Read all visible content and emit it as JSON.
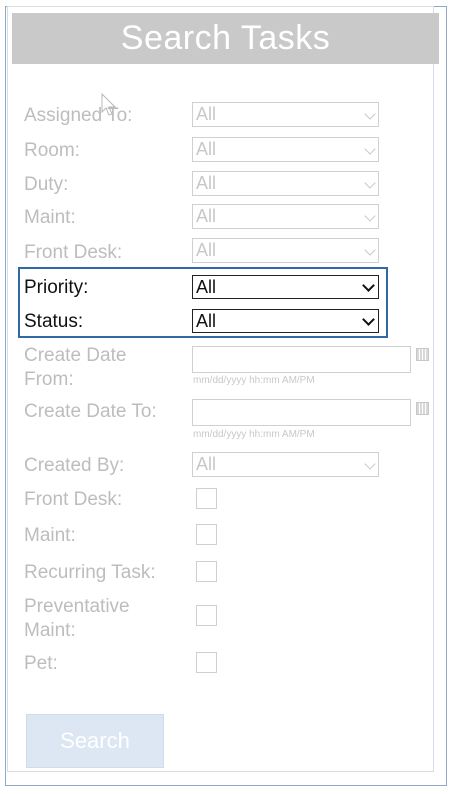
{
  "header": {
    "title": "Search Tasks"
  },
  "filters": {
    "assigned_to": {
      "label": "Assigned To:",
      "value": "All"
    },
    "room": {
      "label": "Room:",
      "value": "All"
    },
    "duty": {
      "label": "Duty:",
      "value": "All"
    },
    "maint": {
      "label": "Maint:",
      "value": "All"
    },
    "front_desk": {
      "label": "Front Desk:",
      "value": "All"
    },
    "priority": {
      "label": "Priority:",
      "value": "All"
    },
    "status": {
      "label": "Status:",
      "value": "All"
    },
    "create_date_from": {
      "label_line1": "Create Date",
      "label_line2": "From:",
      "value": "",
      "hint": "mm/dd/yyyy hh:mm AM/PM"
    },
    "create_date_to": {
      "label": "Create Date To:",
      "value": "",
      "hint": "mm/dd/yyyy hh:mm AM/PM"
    },
    "created_by": {
      "label": "Created By:",
      "value": "All"
    }
  },
  "checkboxes": {
    "front_desk": {
      "label": "Front Desk:",
      "checked": false
    },
    "maint": {
      "label": "Maint:",
      "checked": false
    },
    "recurring_task": {
      "label": "Recurring Task:",
      "checked": false
    },
    "preventative_maint": {
      "label_line1": "Preventative",
      "label_line2": "Maint:",
      "checked": false
    },
    "pet": {
      "label": "Pet:",
      "checked": false
    }
  },
  "actions": {
    "search_label": "Search"
  },
  "colors": {
    "title_bar": "#c9c9c9",
    "highlight_border": "#2f6aa5",
    "search_button_bg": "#dce7f3"
  }
}
